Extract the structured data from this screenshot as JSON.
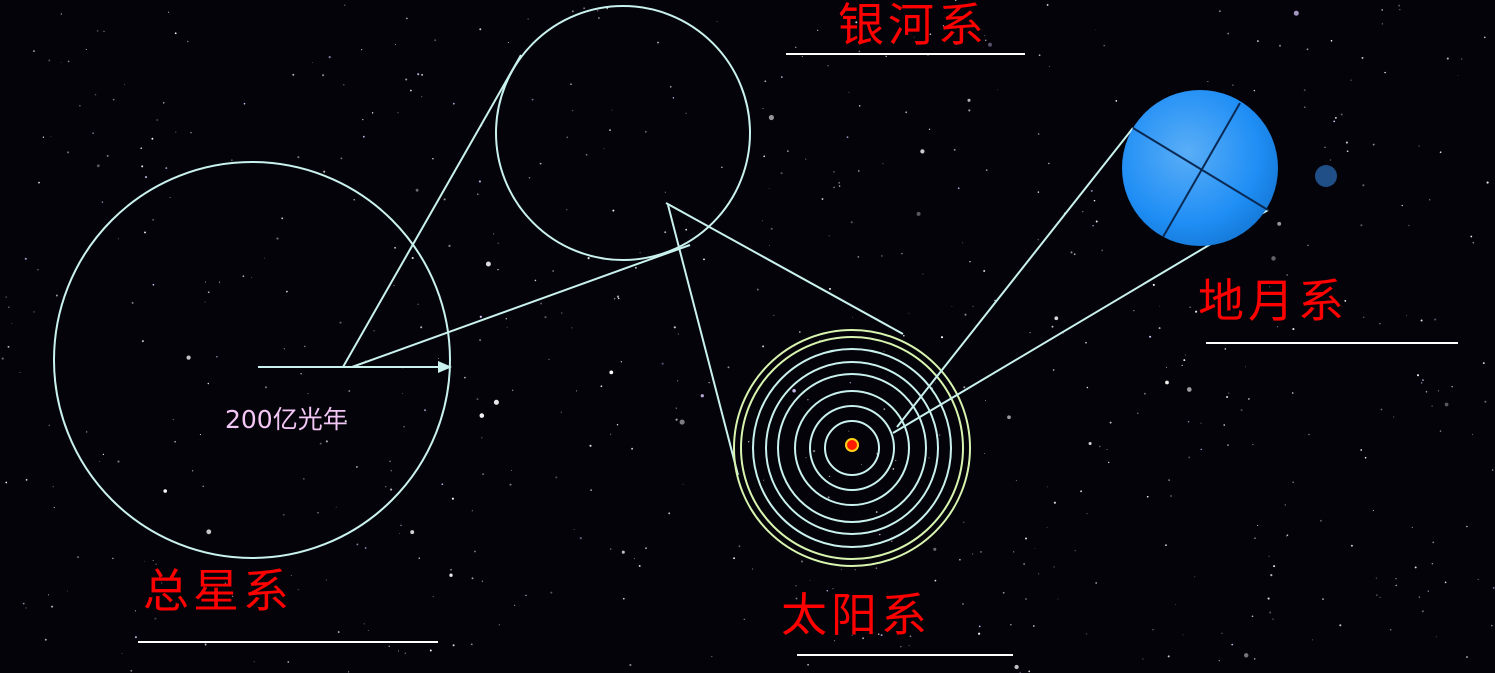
{
  "labels": {
    "universe": "总星系",
    "galaxy": "银河系",
    "solar_system": "太阳系",
    "earth_moon": "地月系"
  },
  "scale": {
    "universe_radius": "200亿光年"
  },
  "colors": {
    "background": "#05030a",
    "outline": "#c9f2ee",
    "label": "#ff0000",
    "scale_text": "#f2c6f5",
    "earth": "#1f8ef5",
    "moon": "#1f4f86",
    "sun": "#ff1a00",
    "sun_rim": "#ffd21a",
    "outer_orbits": "#d8f5b0"
  },
  "icons": {
    "universe": "universe-circle-icon",
    "galaxy": "galaxy-circle-icon",
    "solar_system": "concentric-orbits-icon",
    "earth": "earth-sphere-icon",
    "moon": "moon-dot-icon",
    "sun": "sun-dot-icon"
  }
}
